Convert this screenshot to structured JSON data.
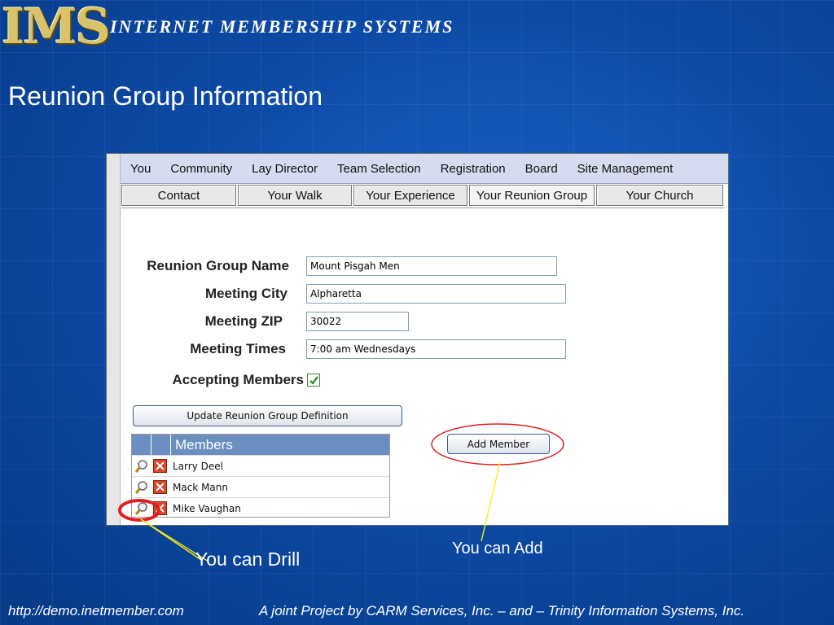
{
  "header": {
    "logo": "IMS",
    "brand": "INTERNET   MEMBERSHIP  SYSTEMS",
    "title": "Reunion Group Information"
  },
  "menu": [
    "You",
    "Community",
    "Lay Director",
    "Team Selection",
    "Registration",
    "Board",
    "Site Management"
  ],
  "tabs": [
    "Contact",
    "Your Walk",
    "Your Experience",
    "Your Reunion Group",
    "Your Church"
  ],
  "form": {
    "name_label": "Reunion Group Name",
    "name_value": "Mount Pisgah Men",
    "city_label": "Meeting City",
    "city_value": "Alpharetta",
    "zip_label": "Meeting ZIP",
    "zip_value": "30022",
    "times_label": "Meeting Times",
    "times_value": "7:00 am Wednesdays",
    "accepting_label": "Accepting Members",
    "accepting_checked": true
  },
  "buttons": {
    "update": "Update Reunion Group Definition",
    "add_member": "Add Member"
  },
  "members": {
    "header": "Members",
    "rows": [
      "Larry Deel",
      "Mack Mann",
      "Mike Vaughan"
    ]
  },
  "annotations": {
    "drill": "You can Drill",
    "add": "You can Add"
  },
  "footer": {
    "url": "http://demo.inetmember.com",
    "credit": "A joint Project by CARM Services, Inc. – and – Trinity Information Systems, Inc."
  },
  "colors": {
    "highlight_circle": "#e02020",
    "pointer_line": "#f5f01a",
    "members_header": "#6a8fc0"
  }
}
